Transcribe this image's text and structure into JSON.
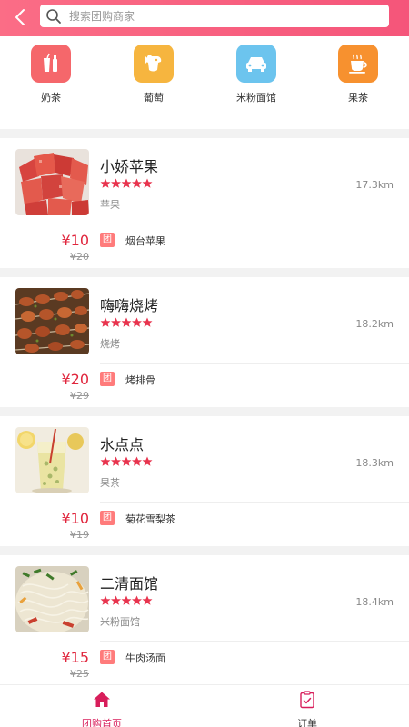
{
  "header": {
    "search_placeholder": "搜索团购商家"
  },
  "categories": [
    {
      "label": "奶茶",
      "icon": "bottle-cup-icon",
      "color": "#f5676b"
    },
    {
      "label": "葡萄",
      "icon": "dog-icon",
      "color": "#f6b53f"
    },
    {
      "label": "米粉面馆",
      "icon": "car-icon",
      "color": "#6cc4ee"
    },
    {
      "label": "果茶",
      "icon": "coffee-cup-icon",
      "color": "#f7912f"
    }
  ],
  "shops": [
    {
      "name": "小娇苹果",
      "category": "苹果",
      "distance": "17.3km",
      "price": "¥10",
      "orig_price": "¥20",
      "tag": "团",
      "deal": "烟台苹果",
      "rating": 5
    },
    {
      "name": "嗨嗨烧烤",
      "category": "烧烤",
      "distance": "18.2km",
      "price": "¥20",
      "orig_price": "¥29",
      "tag": "团",
      "deal": "烤排骨",
      "rating": 5
    },
    {
      "name": "水点点",
      "category": "果茶",
      "distance": "18.3km",
      "price": "¥10",
      "orig_price": "¥19",
      "tag": "团",
      "deal": "菊花雪梨茶",
      "rating": 5
    },
    {
      "name": "二清面馆",
      "category": "米粉面馆",
      "distance": "18.4km",
      "price": "¥15",
      "orig_price": "¥25",
      "tag": "团",
      "deal": "牛肉汤面",
      "rating": 5
    }
  ],
  "tabs": [
    {
      "label": "团购首页",
      "icon": "home-icon",
      "active": true
    },
    {
      "label": "订单",
      "icon": "order-clipboard-icon",
      "active": false
    }
  ],
  "colors": {
    "accent": "#f5557a",
    "price": "#e0263d",
    "star": "#e8344e",
    "tag": "#ff7b7b"
  }
}
